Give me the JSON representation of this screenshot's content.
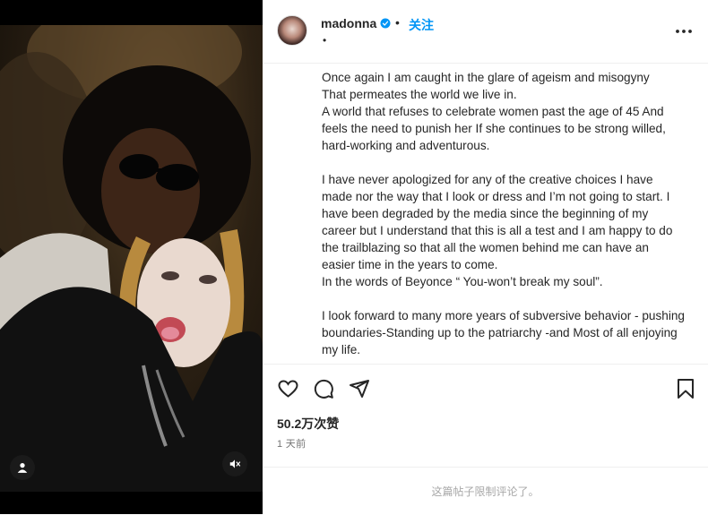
{
  "post": {
    "username": "madonna",
    "verified": true,
    "separator": "•",
    "follow_label": "关注",
    "sub_line": "•",
    "caption": "Once again I am caught in the glare of ageism and misogyny\nThat permeates the world we live in.\nA world that refuses to celebrate women past the age of 45 And feels the need to punish her If she continues to be strong willed, hard-working and adventurous.\n\nI have never apologized for any of the creative choices I have made nor the way that I look or dress and I’m not going to start. I have been degraded by the media since the beginning of my career but I understand that this is all a test and I am happy to do the trailblazing so that all the women behind me can have an easier time in the years to come.\nIn the words of Beyonce “ You-won’t break my soul”.\n\nI look forward to many more years of subversive behavior - pushing boundaries-Standing up to the patriarchy -and Most of all enjoying my life.",
    "likes": "50.2万次赞",
    "timestamp": "1 天前",
    "comments_limited": "这篇帖子限制评论了。"
  },
  "icons": {
    "verified": "verified-badge-icon",
    "more": "more-options-icon",
    "like": "heart-icon",
    "comment": "comment-icon",
    "share": "share-icon",
    "save": "bookmark-icon",
    "tags": "user-tag-icon",
    "mute": "muted-speaker-icon"
  },
  "colors": {
    "accent": "#0095f6",
    "text": "#262626",
    "secondary": "#737373",
    "muted": "#a8a8a8"
  }
}
